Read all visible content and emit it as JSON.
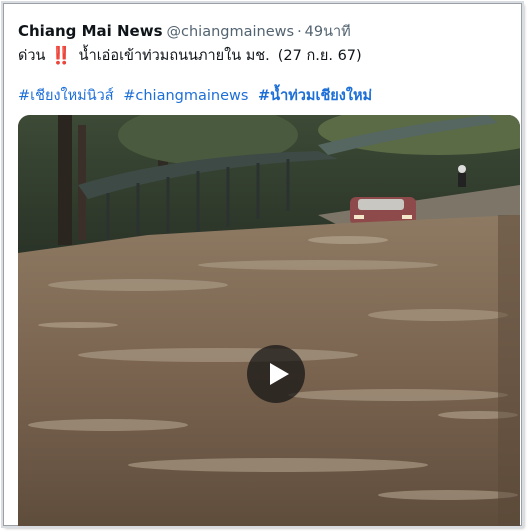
{
  "tweet": {
    "author_name": "Chiang Mai News",
    "author_handle": "@chiangmainews",
    "separator": "·",
    "time_ago": "49นาที",
    "text_line1": {
      "word": "ด่วน",
      "emoji": "‼️",
      "body": "น้ำเอ่อเข้าท่วมถนนภายใน มช.",
      "date": "(27 ก.ย. 67)"
    },
    "hashtags": [
      {
        "text": "#เชียงใหม่นิวส์",
        "bold": false
      },
      {
        "text": "#chiangmainews",
        "bold": false
      },
      {
        "text": "#น้ำท่วมเชียงใหม่",
        "bold": true
      }
    ],
    "media": {
      "type": "video",
      "description_icon": "play-icon",
      "scene": "flooded-road-with-car"
    }
  },
  "colors": {
    "link": "#1d6fd8",
    "secondary_text": "#536471",
    "alert_emoji": "#d91c3c"
  }
}
